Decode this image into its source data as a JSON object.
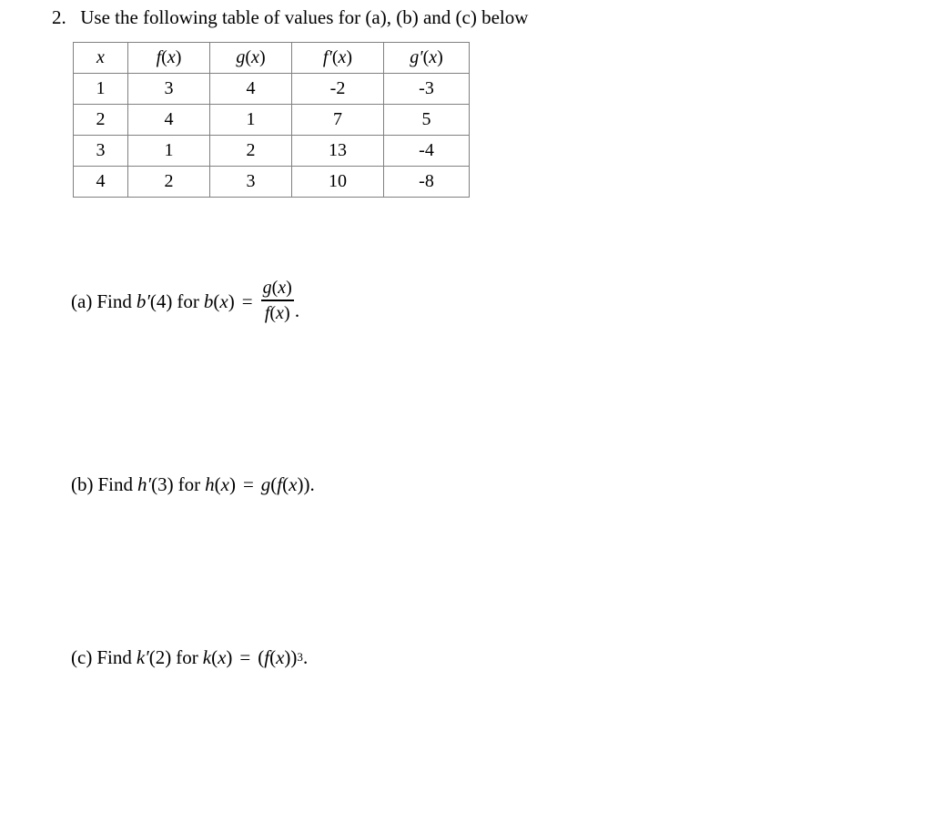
{
  "document": {
    "question_number": "2.",
    "question_text": "Use the following table of values for (a), (b) and (c) below"
  },
  "table": {
    "headers": [
      {
        "var": "x",
        "prime": false
      },
      {
        "var": "f",
        "prime": false,
        "arg": "(x)"
      },
      {
        "var": "g",
        "prime": false,
        "arg": "(x)"
      },
      {
        "var": "f",
        "prime": true,
        "arg": "(x)"
      },
      {
        "var": "g",
        "prime": true,
        "arg": "(x)"
      }
    ],
    "header_labels": [
      "x",
      "f(x)",
      "g(x)",
      "f′(x)",
      "g′(x)"
    ],
    "rows": [
      [
        "1",
        "3",
        "4",
        "-2",
        "-3"
      ],
      [
        "2",
        "4",
        "1",
        "7",
        "5"
      ],
      [
        "3",
        "1",
        "2",
        "13",
        "-4"
      ],
      [
        "4",
        "2",
        "3",
        "10",
        "-8"
      ]
    ],
    "border_color": "#808080"
  },
  "parts": {
    "a": {
      "label": "(a)",
      "find_word": "Find",
      "target_fn": "b",
      "target_prime": "′",
      "target_arg": "(4)",
      "for_word": "for",
      "def_fn": "b(x)",
      "equals": "=",
      "numerator": "g(x)",
      "denominator": "f(x)",
      "period": ".",
      "plain": "(a) Find b′(4) for b(x) = g(x)/f(x)."
    },
    "b": {
      "label": "(b)",
      "find_word": "Find",
      "target_fn": "h",
      "target_prime": "′",
      "target_arg": "(3)",
      "for_word": "for",
      "def_fn": "h(x)",
      "equals": "=",
      "expression": "g(f(x))",
      "period": ".",
      "plain": "(b) Find h′(3) for h(x) = g(f(x))."
    },
    "c": {
      "label": "(c)",
      "find_word": "Find",
      "target_fn": "k",
      "target_prime": "′",
      "target_arg": "(2)",
      "for_word": "for",
      "def_fn": "k(x)",
      "equals": "=",
      "base": "(f(x))",
      "exponent": "3",
      "period": ".",
      "plain": "(c) Find k′(2) for k(x) = (f(x))³."
    }
  }
}
